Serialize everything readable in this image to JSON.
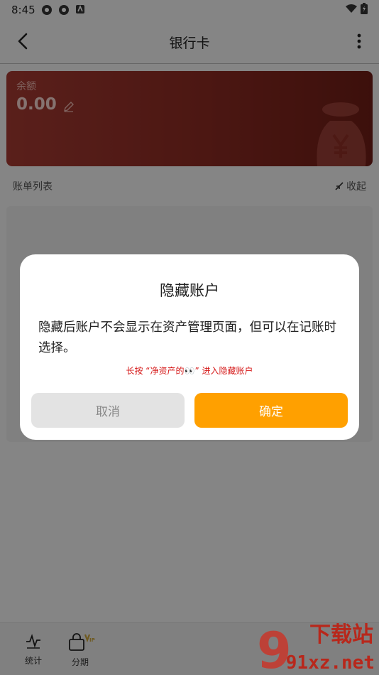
{
  "status_bar": {
    "time": "8:45"
  },
  "app_bar": {
    "title": "银行卡"
  },
  "balance_card": {
    "label": "余额",
    "value": "0.00"
  },
  "section": {
    "title": "账单列表",
    "collapse_label": "收起"
  },
  "bottom_nav": {
    "items": [
      {
        "label": "统计",
        "icon": "chart-line-icon"
      },
      {
        "label": "分期",
        "icon": "shopping-bag-vip-icon"
      }
    ]
  },
  "dialog": {
    "title": "隐藏账户",
    "body": "隐藏后账户不会显示在资产管理页面，但可以在记账时选择。",
    "hint": "长按 “净资产的👀” 进入隐藏账户",
    "cancel_label": "取消",
    "confirm_label": "确定"
  },
  "watermark": {
    "text_top": "下载站",
    "text_bottom": "91xz.net"
  },
  "colors": {
    "card": "#8a2a22",
    "accent": "#ffa000",
    "hint": "#d61b1b"
  }
}
